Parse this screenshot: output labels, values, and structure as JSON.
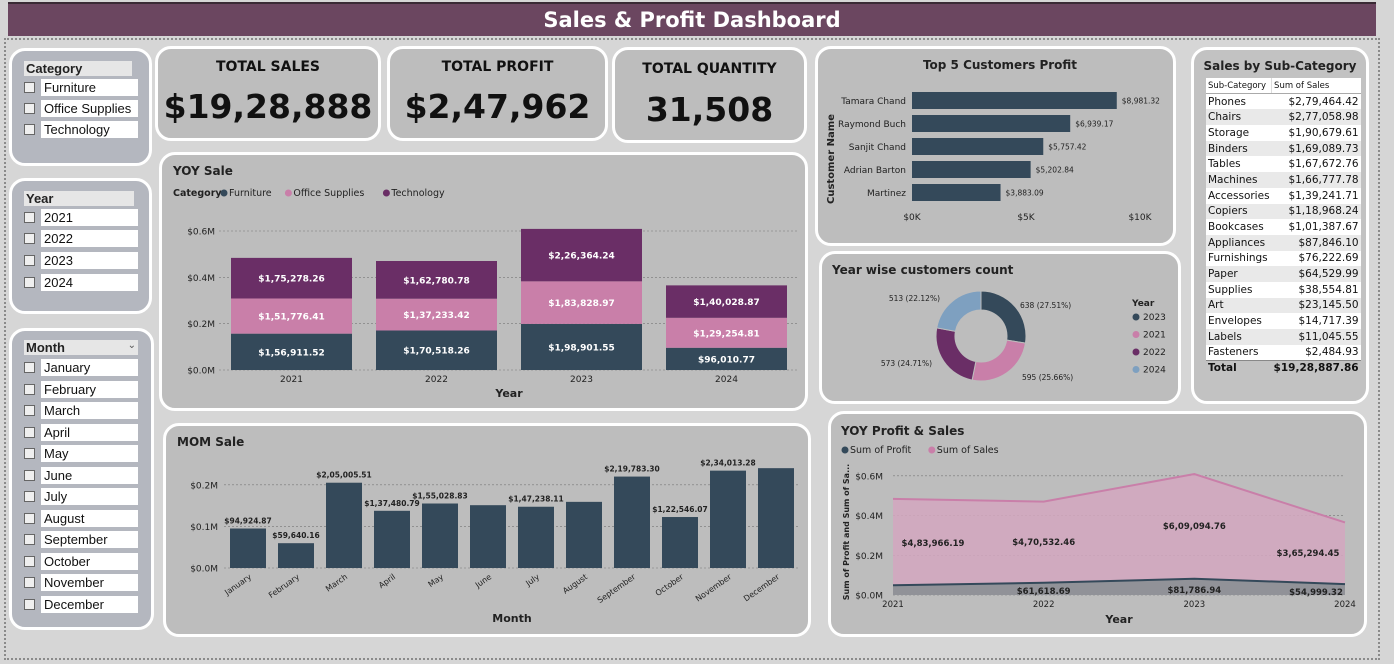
{
  "title": "Sales & Profit Dashboard",
  "slicers": {
    "category": {
      "title": "Category",
      "items": [
        "Furniture",
        "Office Supplies",
        "Technology"
      ]
    },
    "year": {
      "title": "Year",
      "items": [
        "2021",
        "2022",
        "2023",
        "2024"
      ]
    },
    "month": {
      "title": "Month",
      "items": [
        "January",
        "February",
        "March",
        "April",
        "May",
        "June",
        "July",
        "August",
        "September",
        "October",
        "November",
        "December"
      ]
    }
  },
  "kpis": {
    "sales": {
      "label": "TOTAL SALES",
      "value": "$19,28,888"
    },
    "profit": {
      "label": "TOTAL PROFIT",
      "value": "$2,47,962"
    },
    "quantity": {
      "label": "TOTAL QUANTITY",
      "value": "31,508"
    }
  },
  "colors": {
    "furniture": "#34495a",
    "office": "#c97fa9",
    "technology": "#6a2e66",
    "y2023": "#34495a",
    "y2024": "#7ea0c0"
  },
  "subcat": {
    "title": "Sales by Sub-Category",
    "col1": "Sub-Category",
    "col2": "Sum of Sales",
    "rows": [
      [
        "Phones",
        "$2,79,464.42"
      ],
      [
        "Chairs",
        "$2,77,058.98"
      ],
      [
        "Storage",
        "$1,90,679.61"
      ],
      [
        "Binders",
        "$1,69,089.73"
      ],
      [
        "Tables",
        "$1,67,672.76"
      ],
      [
        "Machines",
        "$1,66,777.78"
      ],
      [
        "Accessories",
        "$1,39,241.71"
      ],
      [
        "Copiers",
        "$1,18,968.24"
      ],
      [
        "Bookcases",
        "$1,01,387.67"
      ],
      [
        "Appliances",
        "$87,846.10"
      ],
      [
        "Furnishings",
        "$76,222.69"
      ],
      [
        "Paper",
        "$64,529.99"
      ],
      [
        "Supplies",
        "$38,554.81"
      ],
      [
        "Art",
        "$23,145.50"
      ],
      [
        "Envelopes",
        "$14,717.39"
      ],
      [
        "Labels",
        "$11,045.55"
      ],
      [
        "Fasteners",
        "$2,484.93"
      ]
    ],
    "total_label": "Total",
    "total_value": "$19,28,887.86"
  },
  "chart_data": [
    {
      "id": "yoy-sale",
      "type": "bar",
      "stacked": true,
      "title": "YOY Sale",
      "legend_title": "Category",
      "xlabel": "Year",
      "ylabel": "",
      "categories": [
        "2021",
        "2022",
        "2023",
        "2024"
      ],
      "ylim": [
        0,
        600000
      ],
      "yticks": [
        0,
        200000,
        400000,
        600000
      ],
      "ytick_labels": [
        "$0.0M",
        "$0.2M",
        "$0.4M",
        "$0.6M"
      ],
      "series": [
        {
          "name": "Furniture",
          "values": [
            156911.52,
            170518.26,
            198901.55,
            96010.77
          ],
          "labels": [
            "$1,56,911.52",
            "$1,70,518.26",
            "$1,98,901.55",
            "$96,010.77"
          ]
        },
        {
          "name": "Office Supplies",
          "values": [
            151776.41,
            137233.42,
            183828.97,
            129254.81
          ],
          "labels": [
            "$1,51,776.41",
            "$1,37,233.42",
            "$1,83,828.97",
            "$1,29,254.81"
          ]
        },
        {
          "name": "Technology",
          "values": [
            175278.26,
            162780.78,
            226364.24,
            140028.87
          ],
          "labels": [
            "$1,75,278.26",
            "$1,62,780.78",
            "$2,26,364.24",
            "$1,40,028.87"
          ]
        }
      ]
    },
    {
      "id": "top5-customers",
      "type": "bar",
      "orientation": "horizontal",
      "title": "Top 5 Customers Profit",
      "ylabel": "Customer Name",
      "xlabel": "",
      "categories": [
        "Tamara Chand",
        "Raymond Buch",
        "Sanjit Chand",
        "Adrian Barton",
        "Martinez"
      ],
      "values": [
        8981.32,
        6939.17,
        5757.42,
        5202.84,
        3883.09
      ],
      "labels": [
        "$8,981.32",
        "$6,939.17",
        "$5,757.42",
        "$5,202.84",
        "$3,883.09"
      ],
      "xlim": [
        0,
        10000
      ],
      "xticks": [
        0,
        5000,
        10000
      ],
      "xtick_labels": [
        "$0K",
        "$5K",
        "$10K"
      ]
    },
    {
      "id": "year-customers",
      "type": "pie",
      "donut": true,
      "title": "Year wise customers count",
      "legend_title": "Year",
      "categories": [
        "2023",
        "2021",
        "2022",
        "2024"
      ],
      "values": [
        638,
        595,
        573,
        513
      ],
      "labels": [
        "638 (27.51%)",
        "595 (25.66%)",
        "573 (24.71%)",
        "513 (22.12%)"
      ]
    },
    {
      "id": "mom-sale",
      "type": "bar",
      "title": "MOM Sale",
      "xlabel": "Month",
      "ylabel": "",
      "categories": [
        "January",
        "February",
        "March",
        "April",
        "May",
        "June",
        "July",
        "August",
        "September",
        "October",
        "November",
        "December"
      ],
      "values": [
        94924.87,
        59640.16,
        205005.51,
        137480.79,
        155028.83,
        151000,
        147238.11,
        159000,
        219783.3,
        122546.07,
        234013.28,
        240000
      ],
      "labels": [
        "$94,924.87",
        "$59,640.16",
        "$2,05,005.51",
        "$1,37,480.79",
        "$1,55,028.83",
        "",
        "$1,47,238.11",
        "",
        "$2,19,783.30",
        "$1,22,546.07",
        "$2,34,013.28",
        ""
      ],
      "ylim": [
        0,
        250000
      ],
      "yticks": [
        0,
        100000,
        200000
      ],
      "ytick_labels": [
        "$0.0M",
        "$0.1M",
        "$0.2M"
      ]
    },
    {
      "id": "yoy-profit-sales",
      "type": "area",
      "title": "YOY Profit & Sales",
      "xlabel": "Year",
      "ylabel": "Sum of Profit and Sum of Sa...",
      "x": [
        "2021",
        "2022",
        "2023",
        "2024"
      ],
      "ylim": [
        0,
        700000
      ],
      "yticks": [
        0,
        200000,
        400000,
        600000
      ],
      "ytick_labels": [
        "$0.0M",
        "$0.2M",
        "$0.4M",
        "$0.6M"
      ],
      "series": [
        {
          "name": "Sum of Profit",
          "values": [
            49000,
            61618.69,
            81786.94,
            54999.32
          ],
          "labels": [
            "",
            "$61,618.69",
            "$81,786.94",
            "$54,999.32"
          ]
        },
        {
          "name": "Sum of Sales",
          "values": [
            483966.19,
            470532.46,
            609094.76,
            365294.45
          ],
          "labels": [
            "$4,83,966.19",
            "$4,70,532.46",
            "$6,09,094.76",
            "$3,65,294.45"
          ]
        }
      ]
    }
  ]
}
